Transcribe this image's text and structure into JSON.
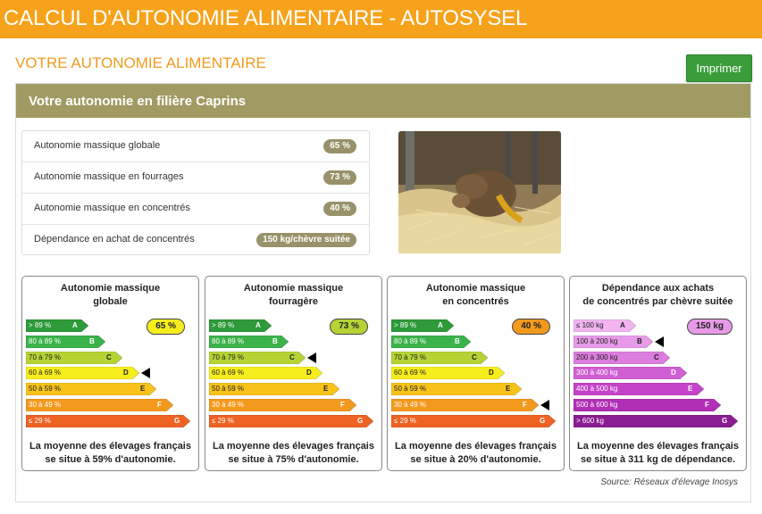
{
  "app": {
    "title": "CALCUL D'AUTONOMIE ALIMENTAIRE - AUTOSYSEL"
  },
  "page": {
    "subtitle": "VOTRE AUTONOMIE ALIMENTAIRE",
    "print_label": "Imprimer"
  },
  "panel": {
    "title": "Votre autonomie en filière Caprins",
    "stats": [
      {
        "label": "Autonomie massique globale",
        "value": "65 %"
      },
      {
        "label": "Autonomie massique en fourrages",
        "value": "73 %"
      },
      {
        "label": "Autonomie massique en concentrés",
        "value": "40 %"
      },
      {
        "label": "Dépendance en achat de concentrés",
        "value": "150 kg/chèvre suitée"
      }
    ],
    "photo": "goat-photo"
  },
  "colors": {
    "header": "#f7a21b",
    "accent_text": "#f29a1c",
    "panel_header": "#a19a63",
    "badge": "#98926a",
    "print_button": "#3a9d3a",
    "scale_percent": [
      "#2e9a3a",
      "#3bb24a",
      "#b5d334",
      "#f6ee1c",
      "#f7c21a",
      "#f39a1e",
      "#ee6223"
    ],
    "scale_purple": [
      "#f1b4f1",
      "#e79ae8",
      "#dc7ede",
      "#d05fd4",
      "#c444c9",
      "#b02fb6",
      "#8a1d92"
    ]
  },
  "cards": [
    {
      "title_line1": "Autonomie massique",
      "title_line2": "globale",
      "value": "65 %",
      "value_color": "#f6ee1c",
      "marker_row": 3,
      "scale": "percent",
      "foot_line1": "La moyenne des élevages français",
      "foot_line2": "se situe à 59% d'autonomie.",
      "bars": [
        {
          "label": "> 89 %",
          "letter": "A"
        },
        {
          "label": "80 à 89 %",
          "letter": "B"
        },
        {
          "label": "70 à 79 %",
          "letter": "C"
        },
        {
          "label": "60 à 69 %",
          "letter": "D"
        },
        {
          "label": "50 à 59 %",
          "letter": "E"
        },
        {
          "label": "30 à 49 %",
          "letter": "F"
        },
        {
          "label": "≤ 29 %",
          "letter": "G"
        }
      ]
    },
    {
      "title_line1": "Autonomie massique",
      "title_line2": "fourragère",
      "value": "73 %",
      "value_color": "#b5d334",
      "marker_row": 2,
      "scale": "percent",
      "foot_line1": "La moyenne des élevages français",
      "foot_line2": "se situe à 75% d'autonomie.",
      "bars": [
        {
          "label": "> 89 %",
          "letter": "A"
        },
        {
          "label": "80 à 89 %",
          "letter": "B"
        },
        {
          "label": "70 à 79 %",
          "letter": "C"
        },
        {
          "label": "60 à 69 %",
          "letter": "D"
        },
        {
          "label": "50 à 59 %",
          "letter": "E"
        },
        {
          "label": "30 à 49 %",
          "letter": "F"
        },
        {
          "label": "≤ 29 %",
          "letter": "G"
        }
      ]
    },
    {
      "title_line1": "Autonomie massique",
      "title_line2": "en concentrés",
      "value": "40 %",
      "value_color": "#f39a1e",
      "marker_row": 5,
      "scale": "percent",
      "foot_line1": "La moyenne des élevages français",
      "foot_line2": "se situe à 20% d'autonomie.",
      "bars": [
        {
          "label": "> 89 %",
          "letter": "A"
        },
        {
          "label": "80 à 89 %",
          "letter": "B"
        },
        {
          "label": "70 à 79 %",
          "letter": "C"
        },
        {
          "label": "60 à 69 %",
          "letter": "D"
        },
        {
          "label": "50 à 59 %",
          "letter": "E"
        },
        {
          "label": "30 à 49 %",
          "letter": "F"
        },
        {
          "label": "≤ 29 %",
          "letter": "G"
        }
      ]
    },
    {
      "title_line1": "Dépendance aux achats",
      "title_line2": "de concentrés par chèvre suitée",
      "value": "150 kg",
      "value_color": "#e79ae8",
      "marker_row": 1,
      "scale": "purple",
      "foot_line1": "La moyenne des élevages français",
      "foot_line2": "se situe à 311 kg de dépendance.",
      "bars": [
        {
          "label": "≤ 100 kg",
          "letter": "A"
        },
        {
          "label": "100 à 200 kg",
          "letter": "B"
        },
        {
          "label": "200 à 300 kg",
          "letter": "C"
        },
        {
          "label": "300 à 400 kg",
          "letter": "D"
        },
        {
          "label": "400 à 500 kg",
          "letter": "E"
        },
        {
          "label": "500 à 600 kg",
          "letter": "F"
        },
        {
          "label": "> 600 kg",
          "letter": "G"
        }
      ]
    }
  ],
  "source": "Source: Réseaux d'élevage Inosys"
}
